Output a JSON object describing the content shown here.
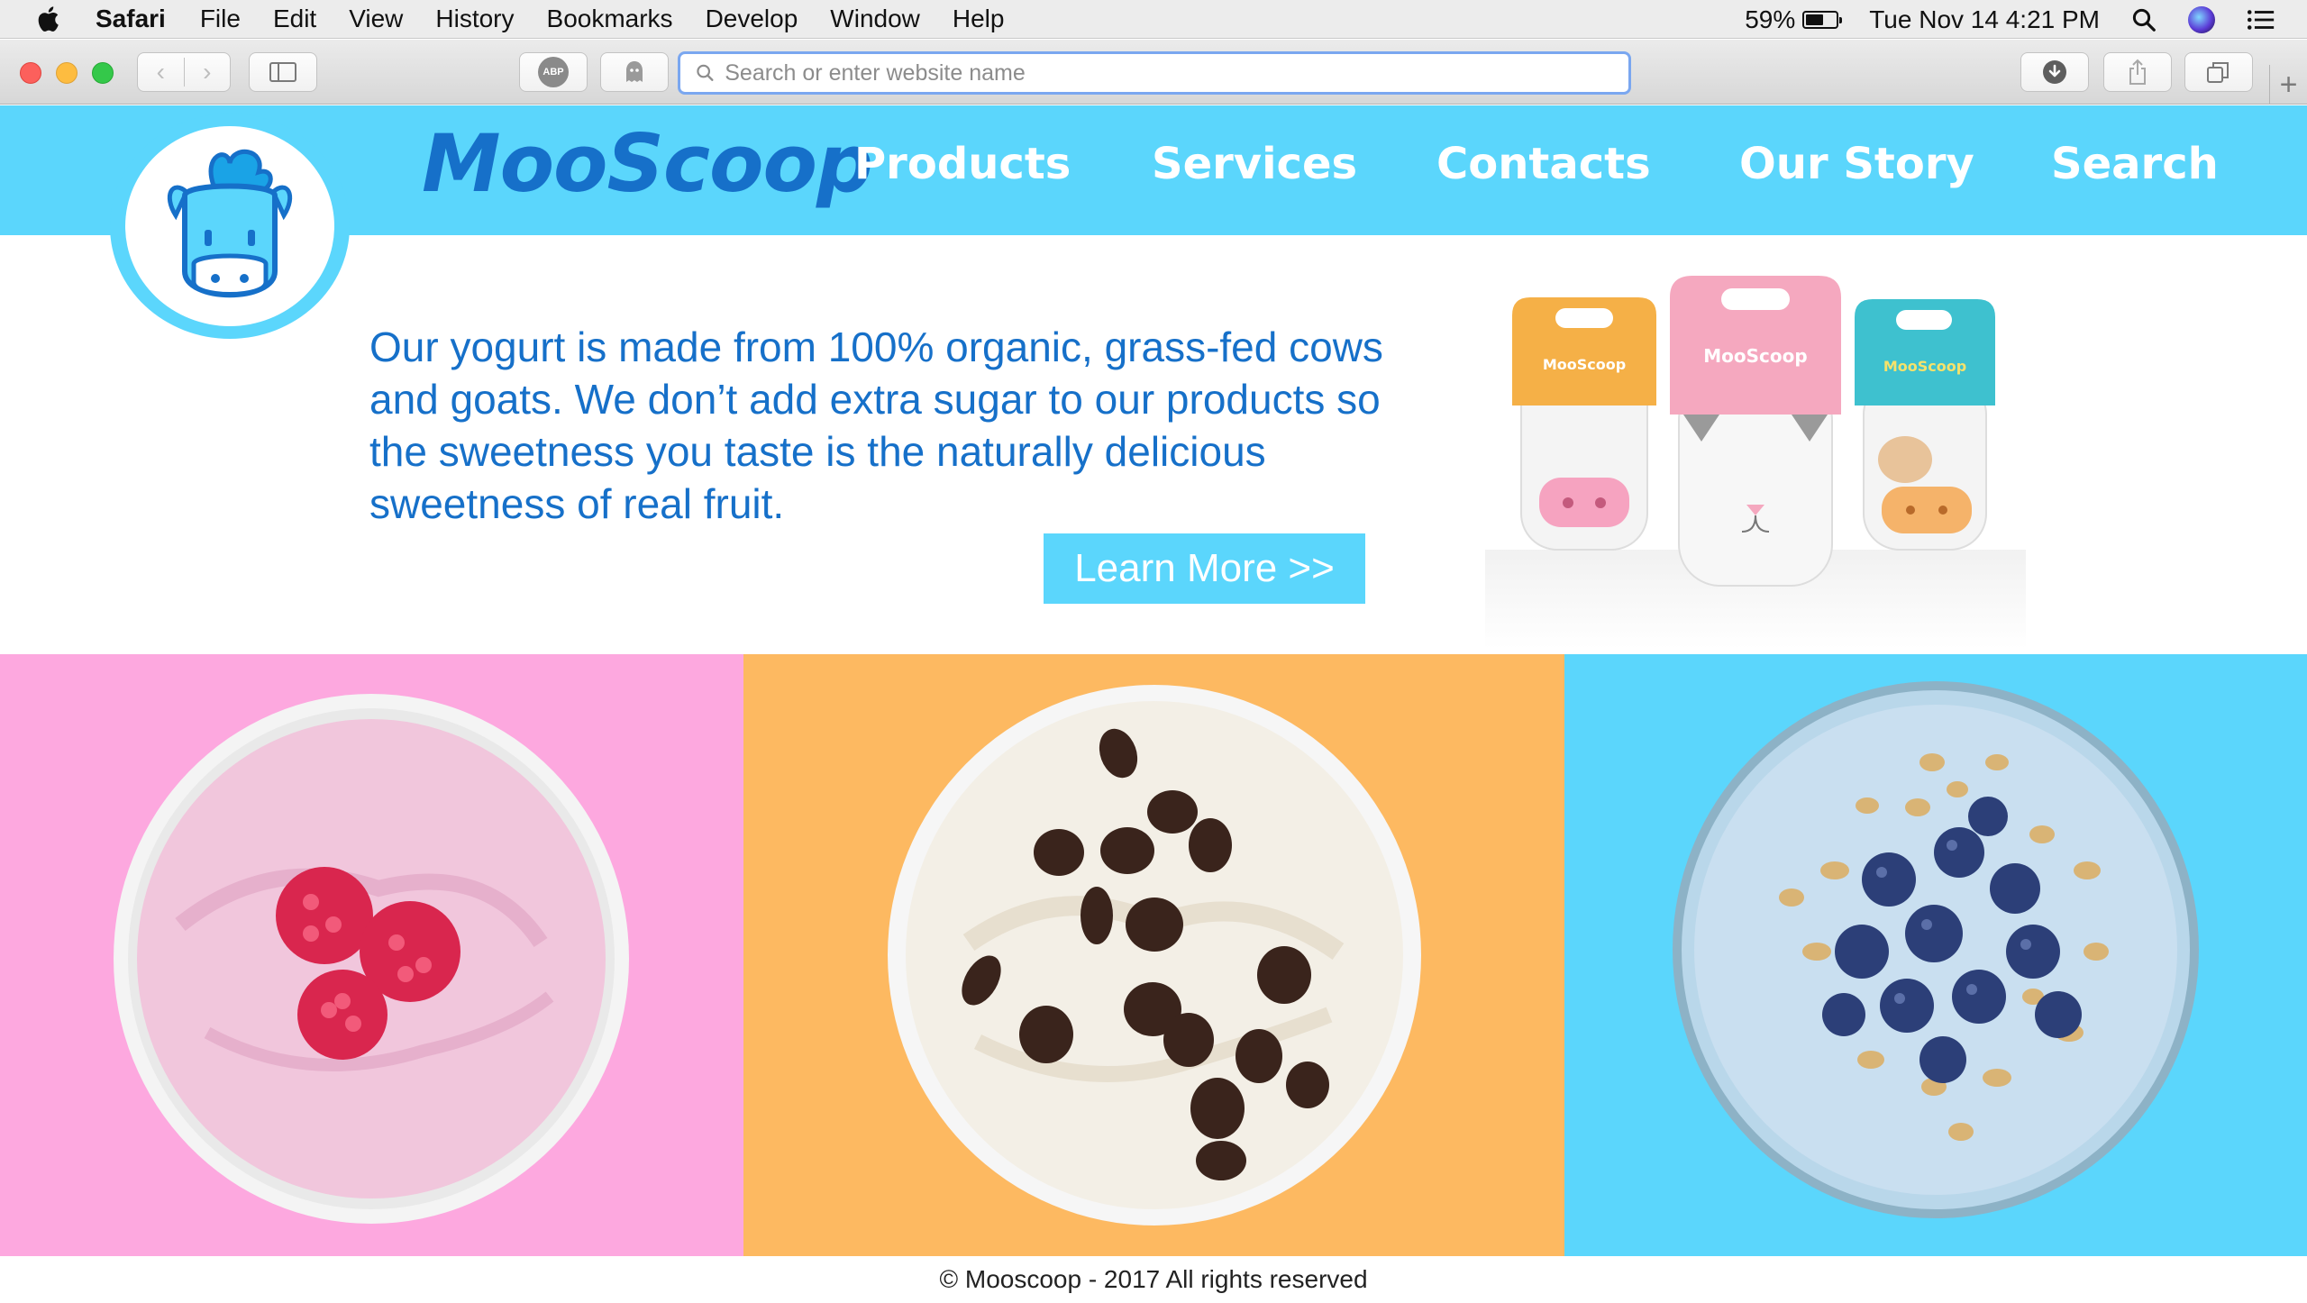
{
  "menubar": {
    "apple_icon": "apple-logo-icon",
    "items": [
      "Safari",
      "File",
      "Edit",
      "View",
      "History",
      "Bookmarks",
      "Develop",
      "Window",
      "Help"
    ],
    "battery_percent": "59%",
    "battery_level": 0.59,
    "datetime": "Tue Nov 14  4:21 PM"
  },
  "toolbar": {
    "address_placeholder": "Search or enter website name",
    "abp_label": "ABP"
  },
  "site": {
    "brand": "MooScoop",
    "nav": [
      "Products",
      "Services",
      "Contacts",
      "Our Story",
      "Search"
    ],
    "hero_text": "Our yogurt is made from 100% organic, grass-fed cows and goats. We don’t add extra sugar to our products so the sweetness you taste is the naturally delicious sweetness of real fruit.",
    "learn_more": "Learn More >>",
    "product_labels": [
      "MooScoop",
      "MooScoop",
      "MooScoop"
    ],
    "footer": "© Mooscoop - 2017 All rights reserved"
  },
  "colors": {
    "header_blue": "#5bd6fc",
    "brand_blue": "#1670c9",
    "panel_pink": "#fda8df",
    "panel_orange": "#fdb961",
    "panel_blue": "#5bd6fc"
  }
}
